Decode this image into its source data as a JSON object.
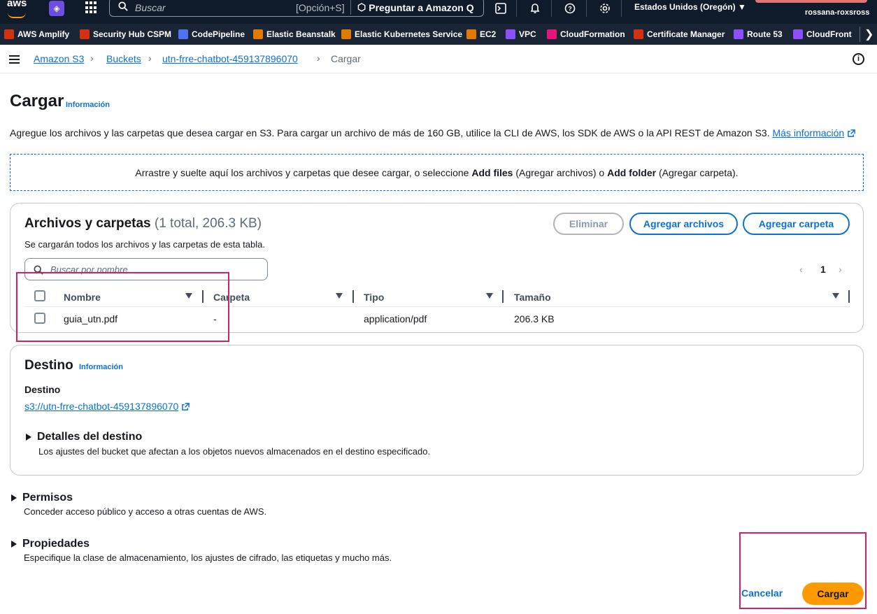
{
  "topnav": {
    "logo_text": "aws",
    "search_placeholder": "Buscar",
    "search_shortcut": "[Opción+S]",
    "ask_q": "Preguntar a Amazon Q",
    "region": "Estados Unidos (Oregón) ▼",
    "user": "rossana-roxsross"
  },
  "favorites": [
    {
      "label": "AWS Amplify",
      "color": "#d13212"
    },
    {
      "label": "Security Hub CSPM",
      "color": "#d13212"
    },
    {
      "label": "CodePipeline",
      "color": "#4d72f3"
    },
    {
      "label": "Elastic Beanstalk",
      "color": "#e07b00"
    },
    {
      "label": "Elastic Kubernetes Service",
      "color": "#e07b00"
    },
    {
      "label": "EC2",
      "color": "#e07b00"
    },
    {
      "label": "VPC",
      "color": "#8c4fff"
    },
    {
      "label": "CloudFormation",
      "color": "#e7157b"
    },
    {
      "label": "Certificate Manager",
      "color": "#d13212"
    },
    {
      "label": "Route 53",
      "color": "#8c4fff"
    },
    {
      "label": "CloudFront",
      "color": "#8c4fff"
    }
  ],
  "breadcrumb": {
    "items": [
      "Amazon S3",
      "Buckets",
      "utn-frre-chatbot-459137896070"
    ],
    "current": "Cargar"
  },
  "page": {
    "title": "Cargar",
    "info": "Información",
    "description": "Agregue los archivos y las carpetas que desea cargar en S3. Para cargar un archivo de más de 160 GB, utilice la CLI de AWS, los SDK de AWS o la API REST de Amazon S3.",
    "more_info": "Más información",
    "drop_text_1": "Arrastre y suelte aquí los archivos y carpetas que desee cargar, o seleccione ",
    "drop_bold_1": "Add files",
    "drop_text_2": " (Agregar archivos) o ",
    "drop_bold_2": "Add folder",
    "drop_text_3": " (Agregar carpeta)."
  },
  "files": {
    "heading": "Archivos y carpetas",
    "count": "(1 total, 206.3 KB)",
    "subtitle": "Se cargarán todos los archivos y las carpetas de esta tabla.",
    "btn_delete": "Eliminar",
    "btn_add_files": "Agregar archivos",
    "btn_add_folder": "Agregar carpeta",
    "search_placeholder": "Buscar por nombre",
    "page": "1",
    "columns": [
      "Nombre",
      "Carpeta",
      "Tipo",
      "Tamaño"
    ],
    "rows": [
      {
        "name": "guia_utn.pdf",
        "folder": "-",
        "type": "application/pdf",
        "size": "206.3 KB"
      }
    ]
  },
  "destination": {
    "heading": "Destino",
    "info": "Información",
    "label": "Destino",
    "link": "s3://utn-frre-chatbot-459137896070",
    "details_title": "Detalles del destino",
    "details_desc": "Los ajustes del bucket que afectan a los objetos nuevos almacenados en el destino especificado."
  },
  "permissions": {
    "title": "Permisos",
    "desc": "Conceder acceso público y acceso a otras cuentas de AWS."
  },
  "properties": {
    "title": "Propiedades",
    "desc": "Especifique la clase de almacenamiento, los ajustes de cifrado, las etiquetas y mucho más."
  },
  "actions": {
    "cancel": "Cancelar",
    "submit": "Cargar"
  }
}
